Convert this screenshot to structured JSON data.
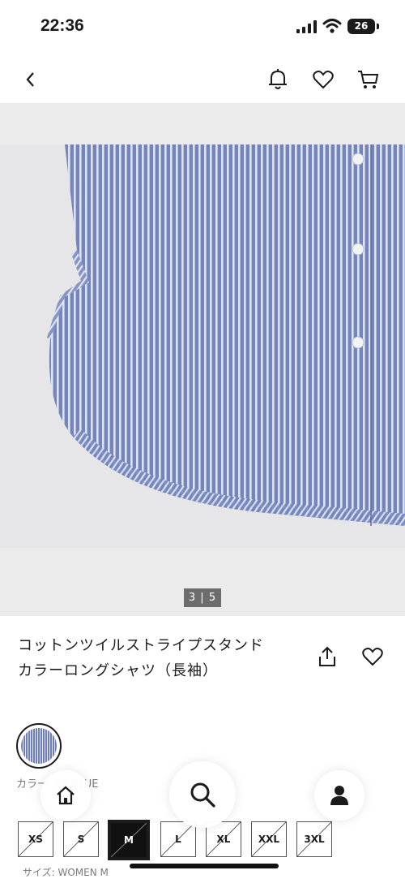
{
  "status_bar": {
    "time": "22:36",
    "battery": "26"
  },
  "product": {
    "image_counter": "3 | 5",
    "title_line1": "コットンツイルストライプスタンド",
    "title_line2": "カラーロングシャツ（長袖）",
    "color_label": "カラー: 68 BLUE",
    "selected_size": "M",
    "size_label": "サイズ: WOMEN M"
  },
  "sizes": [
    "XS",
    "S",
    "M",
    "L",
    "XL",
    "XXL",
    "3XL"
  ],
  "icons": {
    "back": "chevron-left-icon",
    "notification": "bell-icon",
    "favorite": "heart-icon",
    "cart": "cart-icon",
    "share": "share-icon",
    "home": "home-icon",
    "search": "search-icon",
    "account": "person-icon"
  },
  "colors": {
    "stripe_blue": "#6e7fb5",
    "dark": "#1b1b1b",
    "counter_bg": "#6d6d6d"
  }
}
